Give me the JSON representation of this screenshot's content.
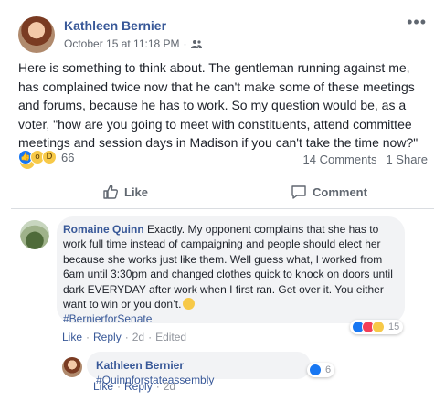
{
  "post": {
    "author": "Kathleen Bernier",
    "timestamp": "October 15 at 11:18 PM",
    "separator": "·",
    "audience_icon": "friends-icon",
    "more_label": "•••",
    "text": "Here is something to think about. The gentleman running against me, has complained twice now that he can't make some of these meetings and forums, because he has to work. So my question would be, as a voter, \"how are you going to meet with constituents, attend committee meetings and session days in Madison if you can't take the time now?\"",
    "reaction_count": "66",
    "comments_count": "14 Comments",
    "shares_count": "1 Share",
    "like_label": "Like",
    "comment_label": "Comment"
  },
  "comments": [
    {
      "author": "Romaine Quinn",
      "text": "Exactly. My opponent complains that she has to work full time instead of campaigning and people should elect her because she works just like them. Well guess what, I worked from 6am until 3:30pm and changed clothes quick to knock on doors until dark EVERYDAY after work when I first ran. Get over it. You either want to win or you don’t.",
      "hashtag": "#BernierforSenate",
      "like": "Like",
      "reply": "Reply",
      "time": "2d",
      "edited": "Edited",
      "dot": "·",
      "reaction_count": "15"
    },
    {
      "author": "Kathleen Bernier",
      "text": "#Quinnforstateassembly",
      "like": "Like",
      "reply": "Reply",
      "time": "2d",
      "dot": "·",
      "reaction_count": "6"
    }
  ],
  "colors": {
    "link": "#385898",
    "like_blue": "#1877f2",
    "muted": "#606770"
  }
}
